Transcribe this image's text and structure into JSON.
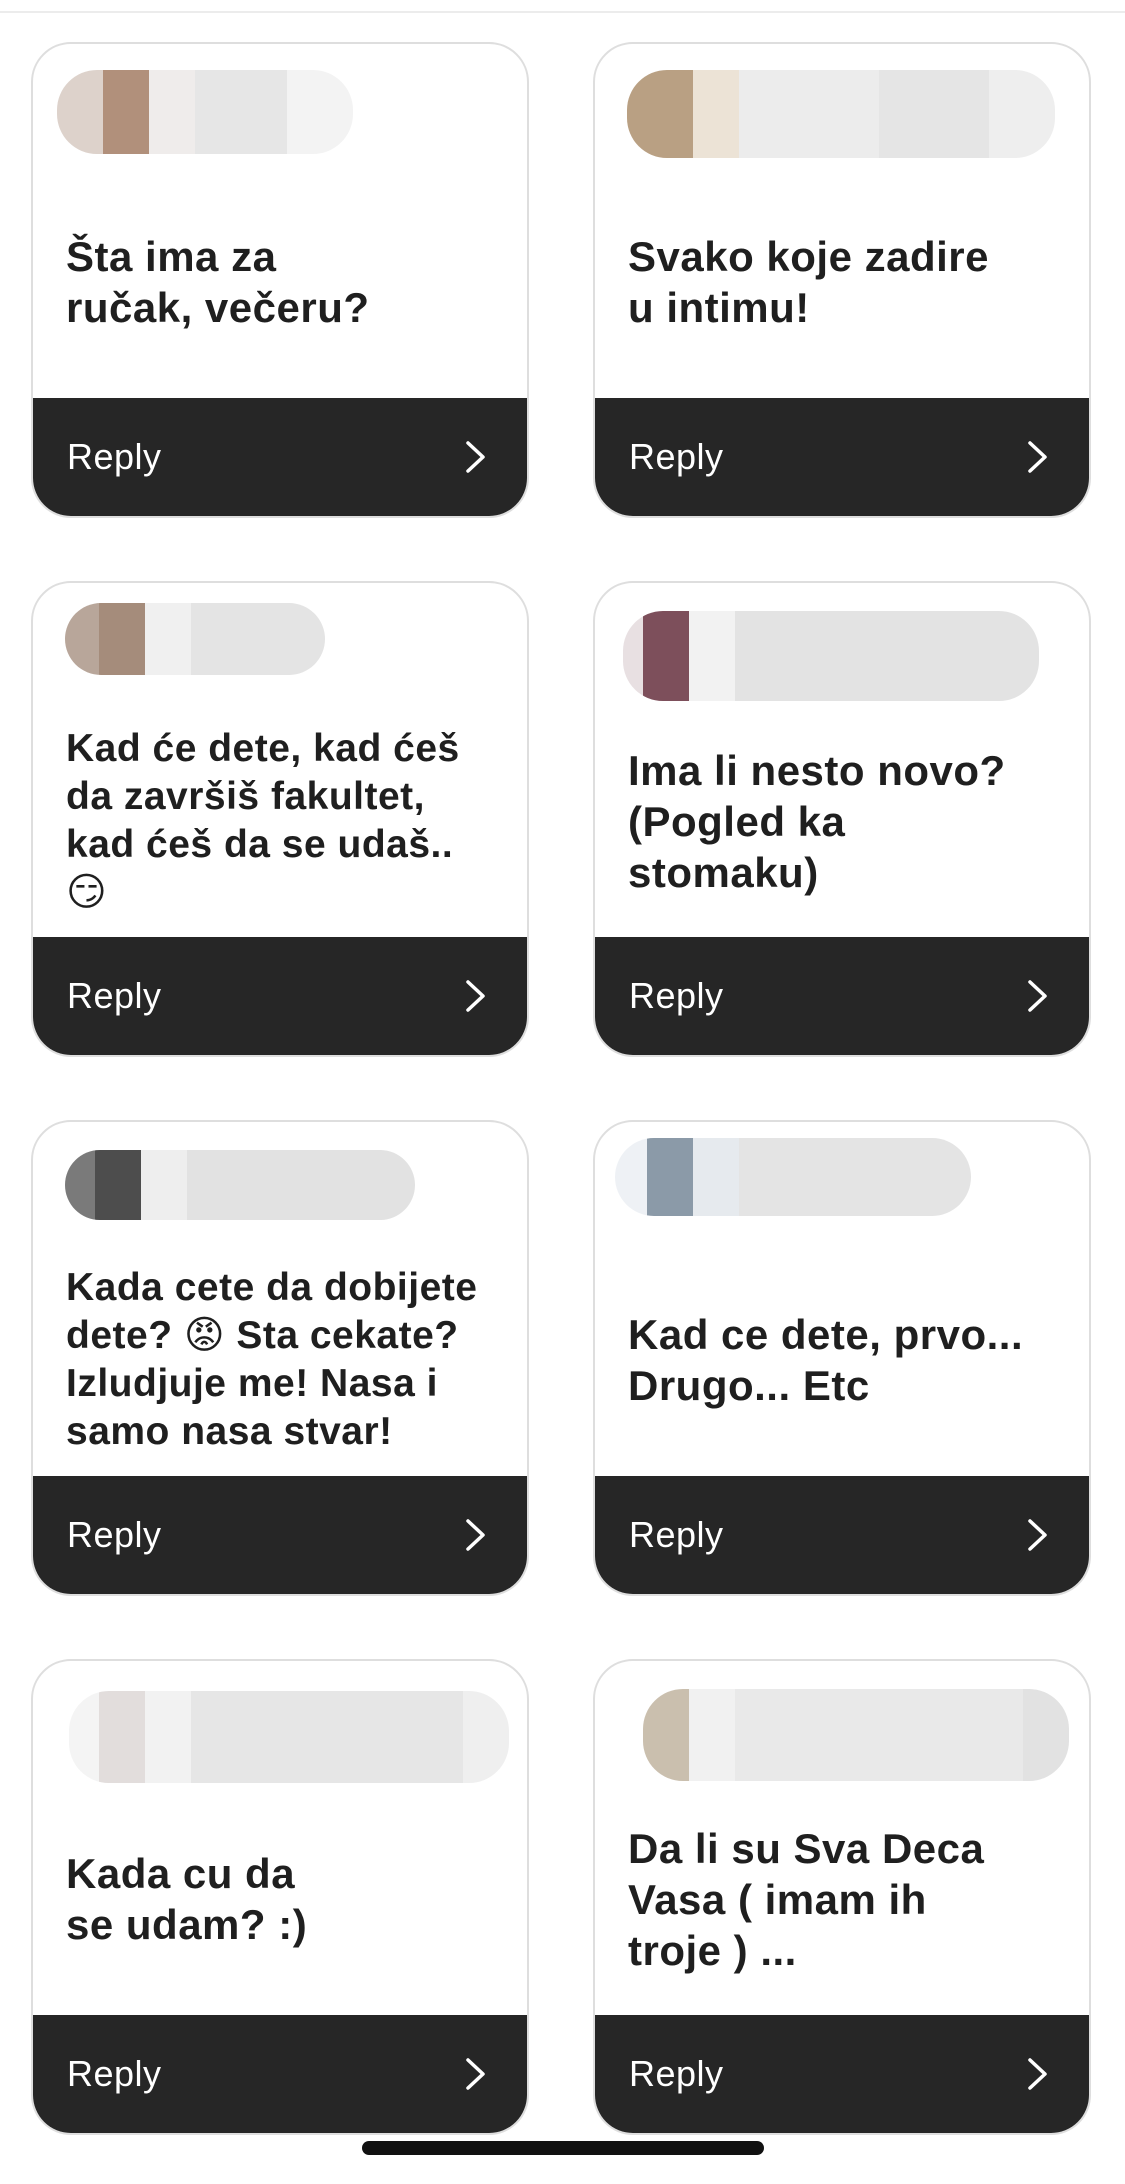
{
  "cards": [
    {
      "question": "Šta ima za\nručak, večeru?",
      "reply_label": "Reply"
    },
    {
      "question": "Svako koje zadire\nu intimu!",
      "reply_label": "Reply"
    },
    {
      "question": "Kad će dete, kad ćeš\nda završiš fakultet,\nkad ćeš da se udaš..\n😏",
      "reply_label": "Reply"
    },
    {
      "question": "Ima li nesto novo?\n(Pogled ka\nstomaku)",
      "reply_label": "Reply"
    },
    {
      "question": "Kada cete da dobijete\ndete? 😡 Sta cekate?\nIzludjuje me! Nasa i\nsamo nasa stvar!",
      "reply_label": "Reply"
    },
    {
      "question": "Kad ce dete, prvo...\nDrugo... Etc",
      "reply_label": "Reply"
    },
    {
      "question": "Kada cu da\nse udam? :)",
      "reply_label": "Reply"
    },
    {
      "question": "Da li su Sva Deca\nVasa ( imam ih\ntroje ) ...",
      "reply_label": "Reply"
    }
  ],
  "colors": {
    "reply_bar": "#262626",
    "card_border": "#dedede",
    "question_text": "#1f1f1f"
  },
  "icons": {
    "reply_arrow": "chevron-right-icon"
  }
}
